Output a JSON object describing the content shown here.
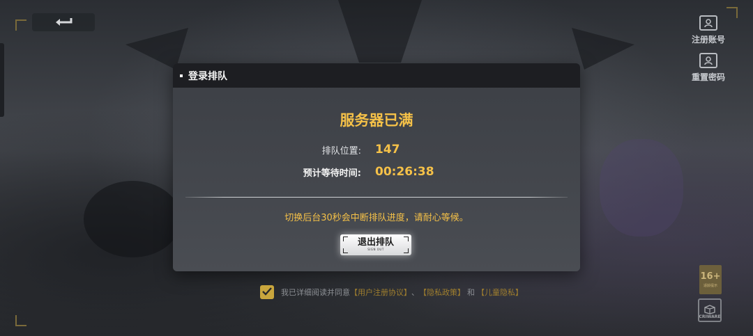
{
  "page": {
    "bg_color": "#3a3d42",
    "accent": "#f5c148"
  },
  "top_right": {
    "register_label": "注册账号",
    "reset_password_label": "重置密码"
  },
  "dialog": {
    "title": "登录排队",
    "status": "服务器已满",
    "queue_position_label": "排队位置:",
    "queue_position_value": "147",
    "eta_label": "预计等待时间:",
    "eta_value": "00:26:38",
    "notice": "切换后台30秒会中断排队进度，请耐心等候。",
    "exit_button": {
      "label": "退出排队",
      "sublabel": "SIGN OUT"
    }
  },
  "agreement": {
    "prefix": "我已详细阅读并同意",
    "user_agreement": "【用户注册协议】",
    "sep1": "、",
    "privacy_policy": "【隐私政策】",
    "sep2": "和",
    "child_privacy": "【儿童隐私】"
  },
  "badges": {
    "age_rating": "16+",
    "age_rating_text": "适龄提示",
    "criware": "CRIWARE"
  },
  "icons": [
    "back-arrow-icon",
    "user-add-icon",
    "user-reset-icon",
    "checkmark-icon"
  ]
}
